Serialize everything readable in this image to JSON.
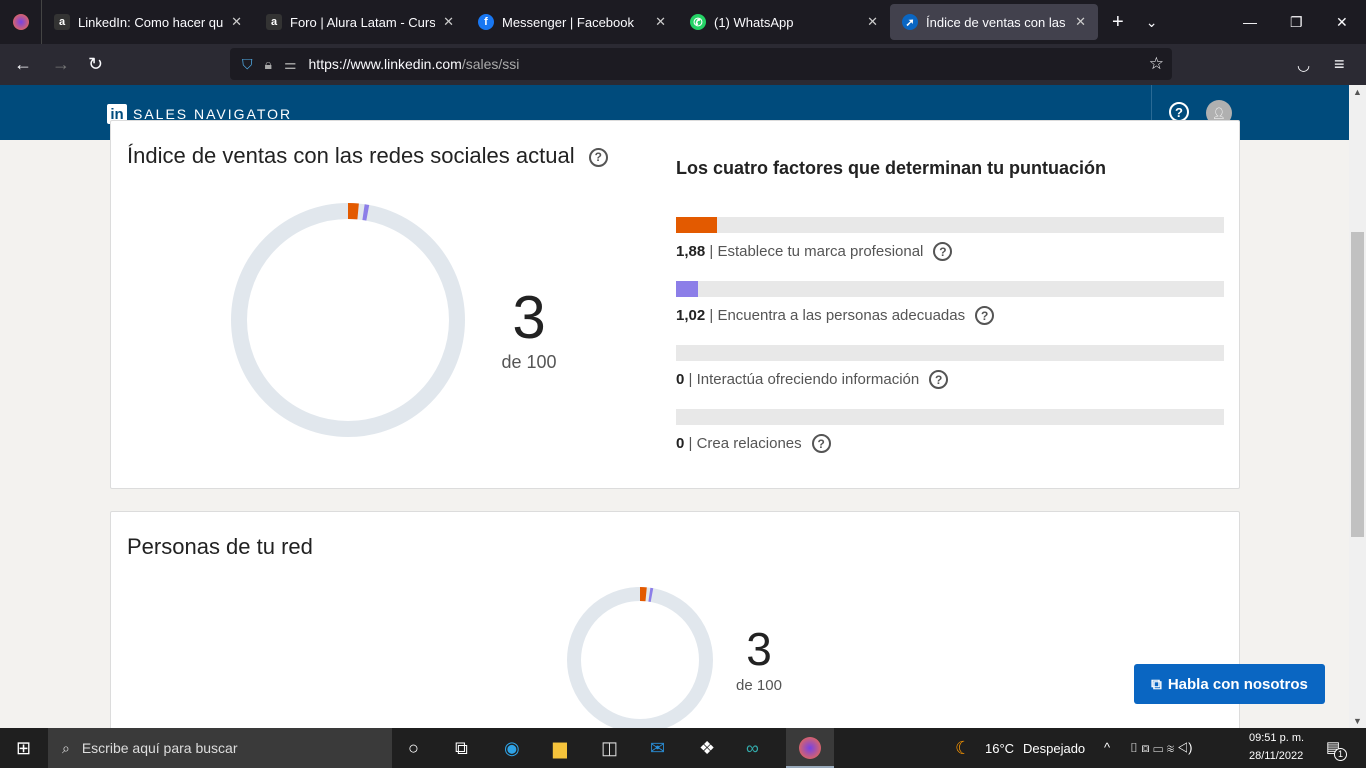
{
  "browser": {
    "tabs": [
      {
        "title": "LinkedIn: Como hacer que tu",
        "icon": "alura-icon",
        "active": false
      },
      {
        "title": "Foro | Alura Latam - Cursos o",
        "icon": "alura-icon",
        "active": false
      },
      {
        "title": "Messenger | Facebook",
        "icon": "facebook-icon",
        "active": false
      },
      {
        "title": "(1) WhatsApp",
        "icon": "whatsapp-icon",
        "active": false
      },
      {
        "title": "Índice de ventas con las redes",
        "icon": "linkedin-sales-icon",
        "active": true
      }
    ],
    "url_host": "https://www.linkedin.com",
    "url_path": "/sales/ssi"
  },
  "header": {
    "brand": "SALES NAVIGATOR",
    "logo": "in"
  },
  "ssi": {
    "title": "Índice de ventas con las redes sociales actual",
    "score": "3",
    "out_of": "de 100",
    "factors_title": "Los cuatro factores que determinan tu puntuación",
    "factor_max": 25,
    "factors": [
      {
        "value": "1,88",
        "num": 1.88,
        "label": "| Establece tu marca profesional",
        "color": "#e35a00"
      },
      {
        "value": "1,02",
        "num": 1.02,
        "label": "| Encuentra a las personas adecuadas",
        "color": "#8c7ee8"
      },
      {
        "value": "0",
        "num": 0,
        "label": "| Interactúa ofreciendo información",
        "color": "#3a9c8c"
      },
      {
        "value": "0",
        "num": 0,
        "label": "| Crea relaciones",
        "color": "#0a66c2"
      }
    ]
  },
  "network": {
    "title": "Personas de tu red",
    "score": "3",
    "out_of": "de 100"
  },
  "chat_button": "Habla con nosotros",
  "taskbar": {
    "search_placeholder": "Escribe aquí para buscar",
    "temp": "16°C",
    "weather": "Despejado",
    "time": "09:51 p. m.",
    "date": "28/11/2022",
    "notifications": "1"
  }
}
